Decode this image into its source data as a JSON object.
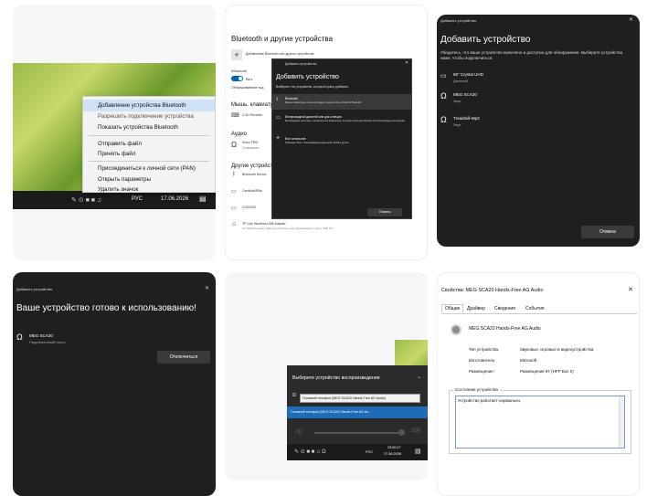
{
  "panel1": {
    "menu_items": [
      "Добавление устройства Bluetooth",
      "Разрешить подключение устройства",
      "Показать устройства Bluetooth",
      "Отправить файл",
      "Принять файл",
      "Присоединиться к личной сети (PAN)",
      "Открыть параметры",
      "Удалить значок"
    ],
    "tray_lang": "РУС",
    "tray_date": "17.06.2026"
  },
  "panel2": {
    "page_title": "Bluetooth и другие устройства",
    "add_row_text": "Добавление Bluetooth или другого устройства",
    "bluetooth_label": "Bluetooth",
    "toggle_state": "Вкл.",
    "discoverable_text": "Обнаруживаемое под",
    "section_mouse": "Мышь, клавиатур",
    "mouse_device": "2.4G Receiver",
    "section_audio": "Аудио",
    "audio_device": "Sonic FRM",
    "audio_status": "Сопряжено",
    "section_other": "Другие устройств",
    "other_device": "Bluetooth Device",
    "list_item_1": "CambiaNRNa",
    "list_item_2": "LCD2000",
    "list_item_3": "TP-Link Wireless USB Adapter",
    "list_item_3_sub": "Устройство может работать быстрее при подключении к порту USB 3.0",
    "dialog_caption": "Добавить устройство",
    "dialog_title": "Добавить устройство",
    "dialog_subtitle": "Выберите тип устройства, который нужно добавить.",
    "opt1_title": "Bluetooth",
    "opt1_desc": "Мыши, клавиатуры, перья или аудио и другие типы устройств Bluetooth",
    "opt2_title": "Беспроводной дисплей или док-станция",
    "opt2_desc": "Беспроводные мониторы, телевизоры или компьютеры, которые используют Miracast или беспроводные док-станции",
    "opt3_title": "Все остальное",
    "opt3_desc": "Геймпады Xbox с беспроводным адаптером, DLNA и другое",
    "cancel_label": "Отмена"
  },
  "panel3": {
    "caption": "Добавить устройство",
    "title": "Добавить устройство",
    "subtitle": "Убедитесь, что ваше устройство включено и доступно для обнаружения. Выберите устройство ниже, чтобы подключиться.",
    "devices": [
      {
        "name": "65\" Crystal UHD",
        "type": "Дисплей"
      },
      {
        "name": "MEG SCA20",
        "type": "Звук"
      },
      {
        "name": "Treadmill-Mp3",
        "type": "Звук"
      }
    ],
    "cancel_label": "Отмена"
  },
  "panel4": {
    "caption": "Добавить устройство",
    "title": "Ваше устройство готово к использованию!",
    "device_name": "MEG SCA20",
    "device_status": "Подключенный голос",
    "disconnect_label": "Отключиться"
  },
  "panel5": {
    "flyout_title": "Выберите устройство воспроизведения",
    "tooltip_text": "Головной телефон (MEG SCA20 Hands-Free AG Audio)",
    "option_label": "Головной телефон (MEG SCA20 Hands-Free AG Au...",
    "volume_value": "100",
    "tray_lang": "РУС",
    "tray_time": "23:50:17",
    "tray_date": "17.06.2026"
  },
  "panel6": {
    "window_title": "Свойства: MEG SCA20 Hands-Free AG Audio",
    "tabs": [
      "Общие",
      "Драйвер",
      "Сведения",
      "События"
    ],
    "device_name": "MEG SCA20 Hands-Free AG Audio",
    "props": [
      {
        "label": "Тип устройства:",
        "value": "Звуковые, игровые и видеоустройства"
      },
      {
        "label": "Изготовитель:",
        "value": "Microsoft"
      },
      {
        "label": "Размещение:",
        "value": "Размещение 97 (HFP Bus 0)"
      }
    ],
    "status_group_label": "Состояние устройства",
    "status_text": "Устройство работает нормально."
  }
}
